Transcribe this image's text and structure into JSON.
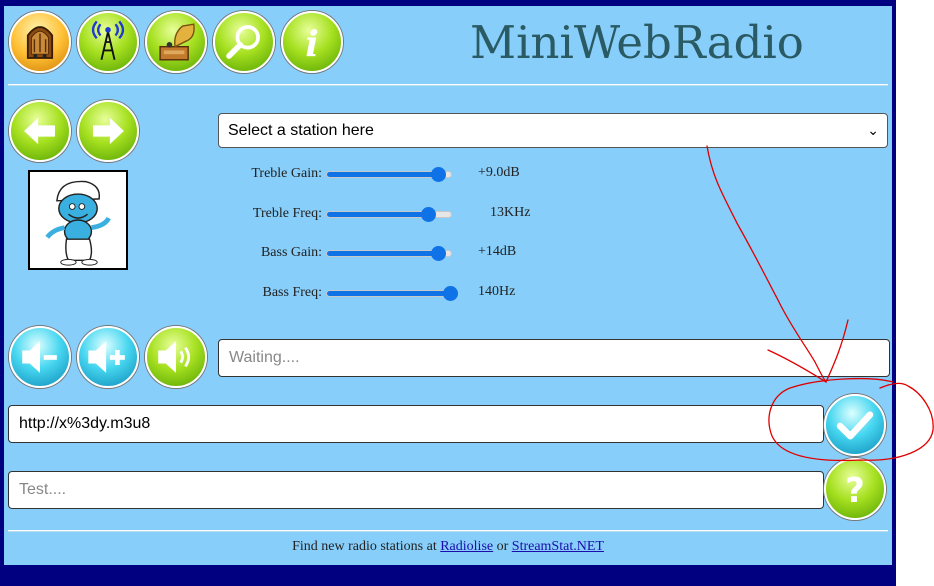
{
  "app": {
    "title": "MiniWebRadio"
  },
  "toolbar": {
    "icons": [
      "radio-icon",
      "antenna-icon",
      "gramophone-icon",
      "search-icon",
      "info-icon"
    ]
  },
  "nav": {
    "prev_icon": "arrow-left-icon",
    "next_icon": "arrow-right-icon"
  },
  "station_select": {
    "selected": "Select a station here"
  },
  "sliders": [
    {
      "label": "Treble Gain:",
      "value_text": "+9.0dB",
      "level": 0.9
    },
    {
      "label": "Treble Freq:",
      "value_text": "13KHz",
      "level": 0.82
    },
    {
      "label": "Bass Gain:",
      "value_text": "+14dB",
      "level": 0.9
    },
    {
      "label": "Bass Freq:",
      "value_text": "140Hz",
      "level": 1.0
    }
  ],
  "status": {
    "placeholder": "Waiting...."
  },
  "url_input": {
    "value": "http://x%3dy.m3u8"
  },
  "test_input": {
    "placeholder": "Test...."
  },
  "footer": {
    "prefix": "Find new radio stations at ",
    "link1": "Radiolise",
    "middle": " or ",
    "link2": "StreamStat.NET"
  },
  "colors": {
    "frame": "#000080",
    "panel": "#87cefa",
    "slider": "#0f72e6",
    "annotation": "#e00000"
  }
}
